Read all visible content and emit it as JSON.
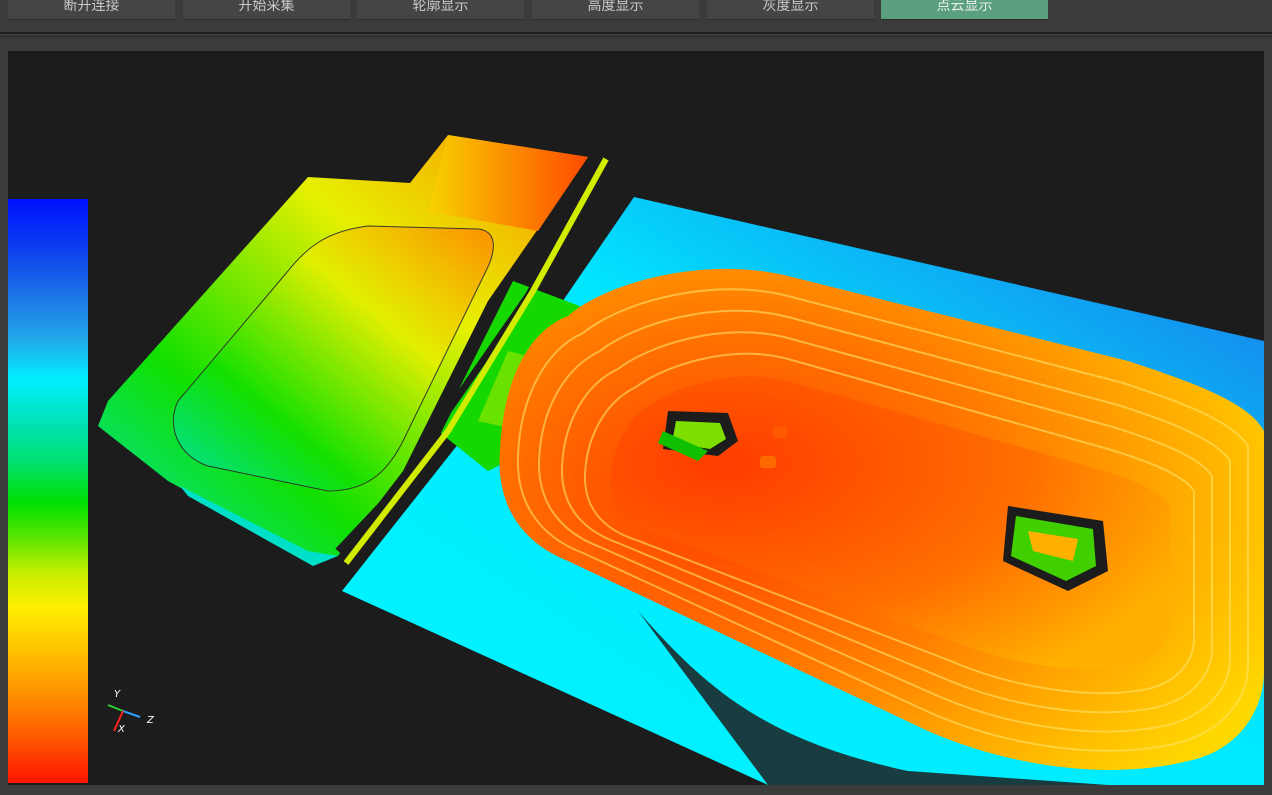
{
  "toolbar": {
    "tabs": [
      {
        "label": "断开连接",
        "active": false
      },
      {
        "label": "开始采集",
        "active": false
      },
      {
        "label": "轮廓显示",
        "active": false
      },
      {
        "label": "高度显示",
        "active": false
      },
      {
        "label": "灰度显示",
        "active": false
      },
      {
        "label": "点云显示",
        "active": true
      }
    ]
  },
  "viewer": {
    "axes": {
      "x": "X",
      "y": "Y",
      "z": "Z"
    },
    "colorbar": {
      "orientation": "vertical",
      "top_color": "#0010ff",
      "bottom_color": "#ff1500"
    }
  },
  "colors": {
    "active_tab": "#5a9f7f",
    "viewport_bg": "#1c1c1d",
    "chrome_bg": "#3b3b3b"
  }
}
